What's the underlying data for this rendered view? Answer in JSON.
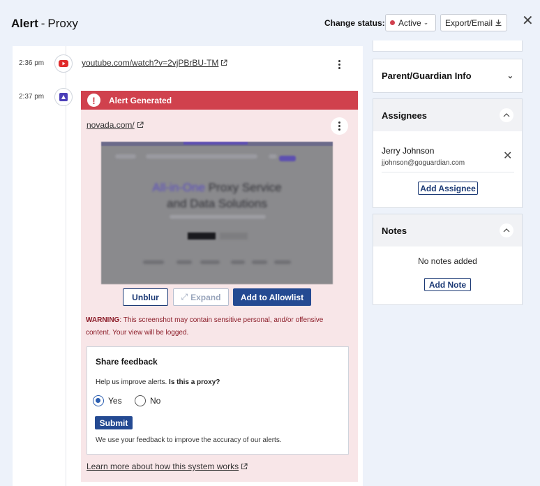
{
  "header": {
    "title_bold": "Alert",
    "title_sep": "-",
    "title_rest": "Proxy",
    "change_status_label": "Change status:",
    "status_value": "Active",
    "export_label": "Export/Email",
    "status_color": "#d1414f"
  },
  "timeline": {
    "items": [
      {
        "time": "2:36 pm",
        "icon": "youtube-icon",
        "link": "youtube.com/watch?v=2vjPBrBU-TM"
      },
      {
        "time": "2:37 pm",
        "icon": "proxy-site-icon",
        "link": "novada.com/"
      }
    ]
  },
  "alert": {
    "title": "Alert Generated",
    "bar_color": "#d0414d",
    "screenshot": {
      "headline_1": "All-in-One",
      "headline_2": "Proxy Service",
      "headline_3": "and Data Solutions"
    },
    "buttons": {
      "unblur": "Unblur",
      "expand": "Expand",
      "allowlist": "Add to Allowlist"
    },
    "warning_label": "WARNING",
    "warning_text": ": This screenshot may contain sensitive personal, and/or offensive content. Your view will be logged.",
    "feedback": {
      "title": "Share feedback",
      "question_prefix": "Help us improve alerts. ",
      "question_bold": "Is this a proxy?",
      "yes": "Yes",
      "no": "No",
      "selected": "Yes",
      "submit": "Submit",
      "note": "We use your feedback to improve the accuracy of our alerts."
    },
    "learn_more": "Learn more about how this system works"
  },
  "sidebar": {
    "parent_title": "Parent/Guardian Info",
    "assignees_title": "Assignees",
    "assignee_name": "Jerry Johnson",
    "assignee_email": "jjohnson@goguardian.com",
    "add_assignee": "Add Assignee",
    "notes_title": "Notes",
    "notes_empty": "No notes added",
    "add_note": "Add Note"
  }
}
